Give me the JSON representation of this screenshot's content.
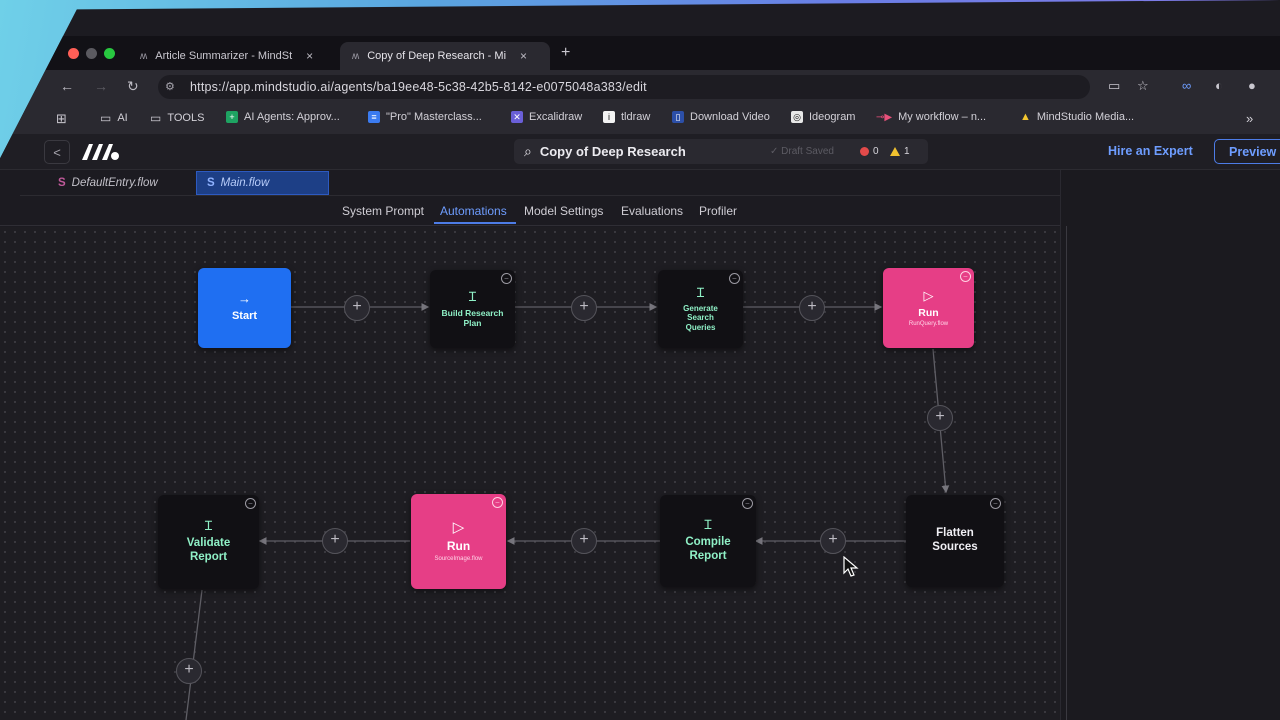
{
  "browser": {
    "tabs": [
      {
        "label": "Article Summarizer - MindSt",
        "close": "×"
      },
      {
        "label": "Copy of Deep Research - Mi",
        "close": "×"
      }
    ],
    "new_tab": "+",
    "url": "https://app.mindstudio.ai/agents/ba19ee48-5c38-42b5-8142-e0075048a383/edit",
    "bookmarks": [
      {
        "label": "AI",
        "icon": "folder-icon"
      },
      {
        "label": "TOOLS",
        "icon": "folder-icon"
      },
      {
        "label": "AI Agents: Approv...",
        "icon": "sheets-icon"
      },
      {
        "label": "\"Pro\" Masterclass...",
        "icon": "docs-icon"
      },
      {
        "label": "Excalidraw",
        "icon": "excalidraw-icon"
      },
      {
        "label": "tldraw",
        "icon": "tldraw-icon"
      },
      {
        "label": "Download Video",
        "icon": "download-icon"
      },
      {
        "label": "Ideogram",
        "icon": "ideogram-icon"
      },
      {
        "label": "My workflow – n...",
        "icon": "n8n-icon"
      },
      {
        "label": "MindStudio Media...",
        "icon": "drive-icon"
      }
    ],
    "more_bookmarks": "»"
  },
  "app": {
    "back": "<",
    "title": "Copy of Deep Research",
    "saved_status": "✓ Draft Saved",
    "error_count": "0",
    "warning_count": "1",
    "hire_expert": "Hire an Expert",
    "preview": "Preview",
    "file_tabs": [
      {
        "label": "DefaultEntry.flow",
        "icon": "S"
      },
      {
        "label": "Main.flow",
        "icon": "S"
      }
    ],
    "sub_tabs": [
      "System Prompt",
      "Automations",
      "Model Settings",
      "Evaluations",
      "Profiler"
    ],
    "active_sub_tab": "Automations"
  },
  "flow": {
    "nodes": {
      "start": {
        "icon": "→",
        "label": "Start"
      },
      "build_plan": {
        "icon": "Ɪ",
        "label": "Build Research Plan"
      },
      "gen_queries": {
        "icon": "Ɪ",
        "label": "Generate Search Queries"
      },
      "run_query": {
        "icon": "▷",
        "label": "Run",
        "sub": "RunQuery.flow"
      },
      "flatten": {
        "label": "Flatten Sources"
      },
      "compile": {
        "icon": "Ɪ",
        "label": "Compile Report"
      },
      "run_image": {
        "icon": "▷",
        "label": "Run",
        "sub": "SourceImage.flow"
      },
      "validate": {
        "icon": "Ɪ",
        "label": "Validate Report"
      }
    },
    "plus": "+",
    "close": "–"
  },
  "colors": {
    "accent_blue": "#1f6ff2",
    "run_pink": "#e63e86",
    "node_text_green": "#8ff0c6",
    "link_blue": "#6e9dff"
  }
}
